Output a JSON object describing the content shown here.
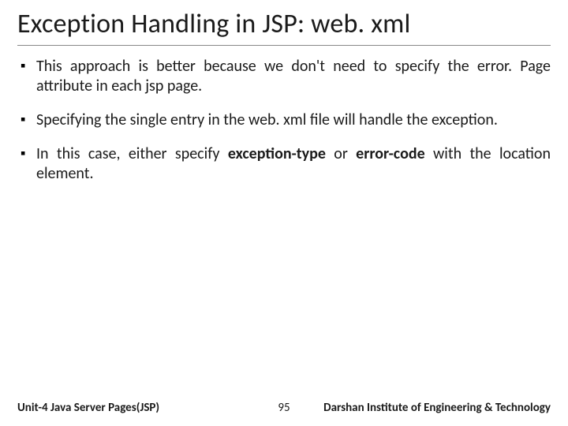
{
  "title": "Exception Handling in JSP: web. xml",
  "bullets": [
    "This approach is better because we don't need to specify the error. Page attribute in each jsp page.",
    "Specifying the single entry in the web. xml file will handle the exception."
  ],
  "bullet3": {
    "pre": "In this case, either specify ",
    "em1": "exception-type",
    "mid": " or ",
    "em2": "error-code",
    "post": " with the location element."
  },
  "footer": {
    "left": "Unit-4 Java Server Pages(JSP)",
    "page": "95",
    "right": "Darshan Institute of Engineering & Technology"
  }
}
